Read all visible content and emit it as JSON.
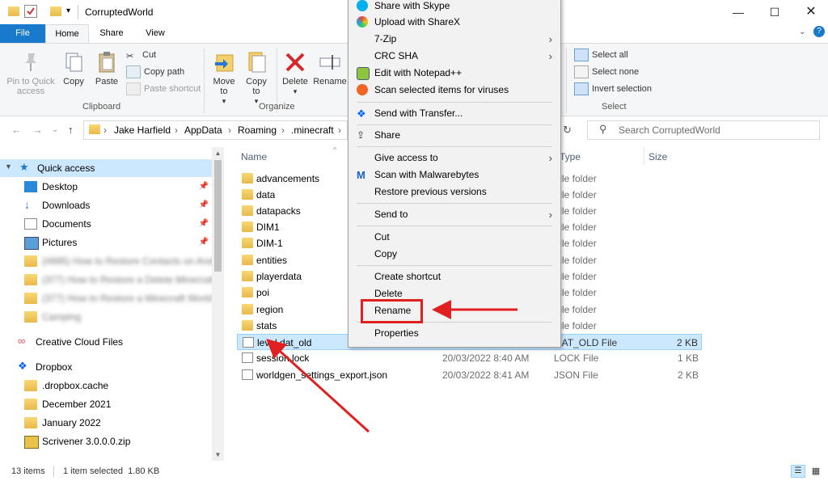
{
  "window": {
    "title": "CorruptedWorld"
  },
  "tabs": {
    "file": "File",
    "home": "Home",
    "share": "Share",
    "view": "View"
  },
  "ribbon": {
    "pin": "Pin to Quick access",
    "copy": "Copy",
    "paste": "Paste",
    "cut": "Cut",
    "copy_path": "Copy path",
    "paste_shortcut": "Paste shortcut",
    "clipboard_group": "Clipboard",
    "move_to": "Move to",
    "copy_to": "Copy to",
    "delete": "Delete",
    "rename": "Rename",
    "organize_group": "Organize",
    "select_all": "Select all",
    "select_none": "Select none",
    "invert_selection": "Invert selection",
    "select_group": "Select"
  },
  "address": {
    "crumbs": [
      "Jake Harfield",
      "AppData",
      "Roaming",
      ".minecraft"
    ],
    "search_placeholder": "Search CorruptedWorld"
  },
  "nav": {
    "quick_access": "Quick access",
    "desktop": "Desktop",
    "downloads": "Downloads",
    "documents": "Documents",
    "pictures": "Pictures",
    "blurred1": "(#895) How to Restore Contacts on Andr",
    "blurred2": "(377) How to Restore a Delete Minecraft",
    "blurred3": "(377) How to Restore a Minecraft World",
    "blurred4": "Camping",
    "creative_cloud": "Creative Cloud Files",
    "dropbox": "Dropbox",
    "dropbox_cache": ".dropbox.cache",
    "dec2021": "December 2021",
    "jan2022": "January 2022",
    "scrivener": "Scrivener 3.0.0.0.zip"
  },
  "columns": {
    "name": "Name",
    "type": "Type",
    "size": "Size"
  },
  "files": [
    {
      "name": "advancements",
      "date": "",
      "type": "File folder",
      "size": ""
    },
    {
      "name": "data",
      "date": "",
      "type": "File folder",
      "size": ""
    },
    {
      "name": "datapacks",
      "date": "",
      "type": "File folder",
      "size": ""
    },
    {
      "name": "DIM1",
      "date": "",
      "type": "File folder",
      "size": ""
    },
    {
      "name": "DIM-1",
      "date": "",
      "type": "File folder",
      "size": ""
    },
    {
      "name": "entities",
      "date": "",
      "type": "File folder",
      "size": ""
    },
    {
      "name": "playerdata",
      "date": "",
      "type": "File folder",
      "size": ""
    },
    {
      "name": "poi",
      "date": "",
      "type": "File folder",
      "size": ""
    },
    {
      "name": "region",
      "date": "",
      "type": "File folder",
      "size": ""
    },
    {
      "name": "stats",
      "date": "",
      "type": "File folder",
      "size": ""
    },
    {
      "name": "level.dat_old",
      "date": "",
      "type": "DAT_OLD File",
      "size": "2 KB"
    },
    {
      "name": "session.lock",
      "date": "20/03/2022 8:40 AM",
      "type": "LOCK File",
      "size": "1 KB"
    },
    {
      "name": "worldgen_settings_export.json",
      "date": "20/03/2022 8:41 AM",
      "type": "JSON File",
      "size": "2 KB"
    }
  ],
  "context_menu": {
    "share_skype": "Share with Skype",
    "upload_sharex": "Upload with ShareX",
    "zip7": "7-Zip",
    "crc_sha": "CRC SHA",
    "notepadpp": "Edit with Notepad++",
    "scan_viruses": "Scan selected items for viruses",
    "send_transfer": "Send with Transfer...",
    "share": "Share",
    "give_access": "Give access to",
    "malwarebytes": "Scan with Malwarebytes",
    "restore_versions": "Restore previous versions",
    "send_to": "Send to",
    "cut": "Cut",
    "copy": "Copy",
    "create_shortcut": "Create shortcut",
    "delete": "Delete",
    "rename": "Rename",
    "properties": "Properties"
  },
  "status": {
    "items": "13 items",
    "selected": "1 item selected  1.80 KB"
  },
  "colors": {
    "accent": "#1979ca",
    "selection": "#cce8ff",
    "annotation": "#e02020"
  }
}
